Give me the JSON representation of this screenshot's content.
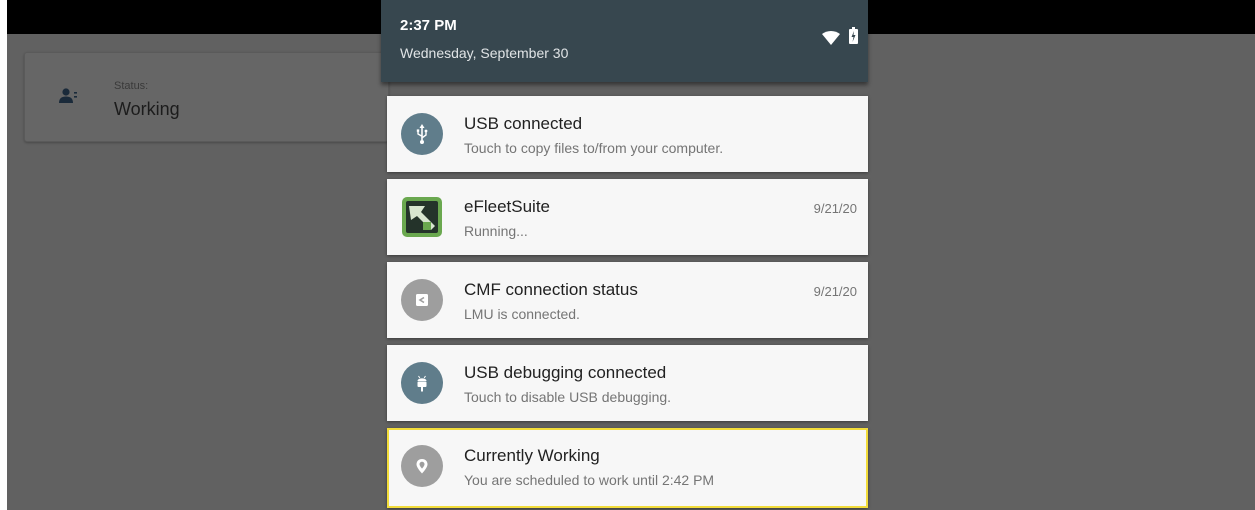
{
  "status_card": {
    "label": "Status:",
    "value": "Working",
    "icon": "person-icon"
  },
  "shade": {
    "time": "2:37 PM",
    "date": "Wednesday, September 30",
    "icons": [
      "wifi-icon",
      "battery-icon"
    ]
  },
  "notifications": [
    {
      "title": "USB connected",
      "text": "Touch to copy files to/from your computer.",
      "when": "",
      "icon": "usb-icon"
    },
    {
      "title": "eFleetSuite",
      "text": "Running...",
      "when": "9/21/20",
      "icon": "efleetsuite-app-icon"
    },
    {
      "title": "CMF connection status",
      "text": "LMU is connected.",
      "when": "9/21/20",
      "icon": "cmf-icon"
    },
    {
      "title": "USB debugging connected",
      "text": "Touch to disable USB debugging.",
      "when": "",
      "icon": "android-debug-icon"
    },
    {
      "title": "Currently Working",
      "text": "You are scheduled to work until 2:42 PM",
      "when": "",
      "icon": "location-icon"
    }
  ],
  "colors": {
    "scrim": "#616161",
    "shade_header": "#37474f",
    "card": "#f7f7f7",
    "icon_slate": "#607d8b",
    "icon_grey": "#9e9e9e",
    "focus": "#f2dc3a",
    "app_green": "#6aa84f"
  }
}
